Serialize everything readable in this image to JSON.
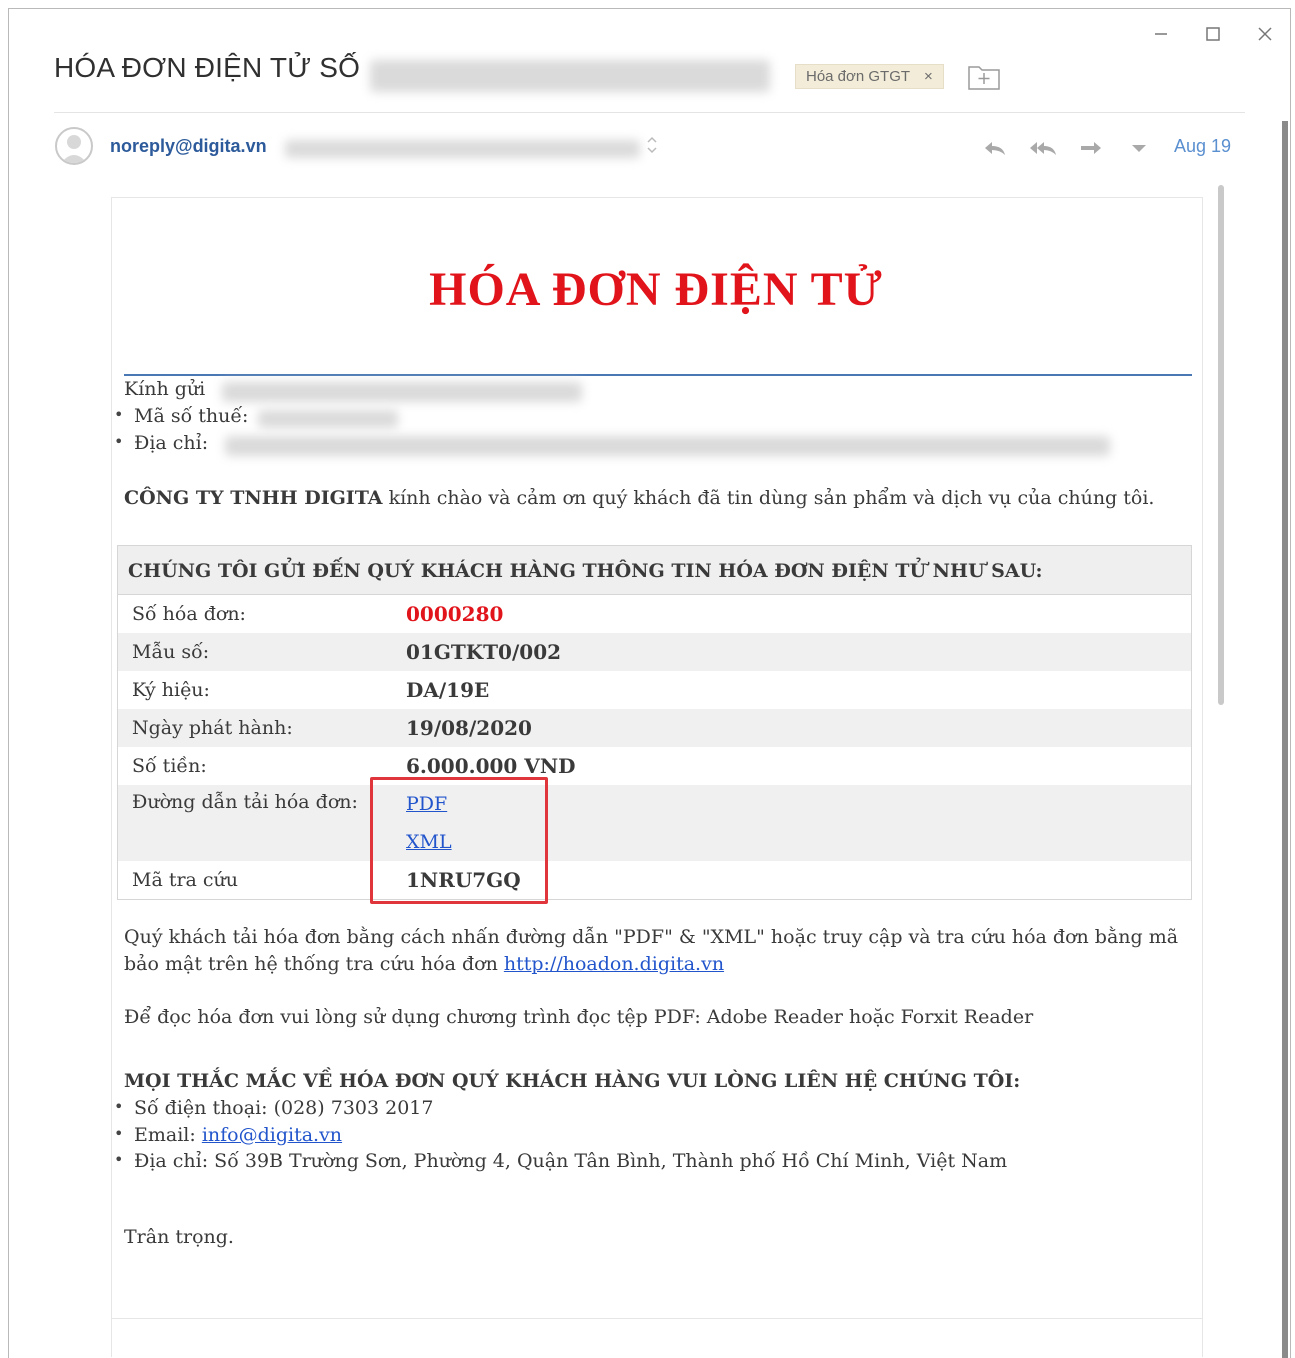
{
  "window": {
    "controls": [
      "minimize",
      "maximize",
      "close"
    ]
  },
  "header": {
    "subject": "HÓA ĐƠN ĐIỆN TỬ SỐ",
    "tag_label": "Hóa đơn GTGT",
    "tag_close": "×"
  },
  "message": {
    "sender": "noreply@digita.vn",
    "date": "Aug 19",
    "actions": [
      "reply",
      "reply-all",
      "forward",
      "more"
    ]
  },
  "body": {
    "title": "HÓA ĐƠN ĐIỆN TỬ",
    "salutation": "Kính gửi",
    "tax_code_label": "Mã số thuế:",
    "address_label": "Địa chỉ:",
    "company_name": "CÔNG TY TNHH DIGITA",
    "greeting": " kính chào và cảm ơn quý khách đã tin dùng sản phẩm và dịch vụ của chúng tôi.",
    "table_header": "CHÚNG TÔI GỬI ĐẾN QUÝ KHÁCH HÀNG THÔNG TIN HÓA ĐƠN ĐIỆN TỬ NHƯ SAU:",
    "rows": [
      {
        "label": "Số hóa đơn:",
        "value": "0000280"
      },
      {
        "label": "Mẫu số:",
        "value": "01GTKT0/002"
      },
      {
        "label": "Ký hiệu:",
        "value": "DA/19E"
      },
      {
        "label": "Ngày phát hành:",
        "value": "19/08/2020"
      },
      {
        "label": "Số tiền:",
        "value": "6.000.000 VND"
      }
    ],
    "download_label": "Đường dẫn tải hóa đơn:",
    "link_pdf": "PDF",
    "link_xml": "XML",
    "lookup_label": "Mã tra cứu",
    "lookup_value": "1NRU7GQ",
    "instruction_line1": "Quý khách tải hóa đơn bằng cách nhấn đường dẫn \"PDF\" & \"XML\" hoặc truy cập và tra cứu hóa đơn bằng mã",
    "instruction_line2": "bảo mật trên hệ thống tra cứu hóa đơn ",
    "lookup_url": "http://hoadon.digita.vn",
    "reader_note": "Để đọc hóa đơn vui lòng sử dụng chương trình đọc tệp PDF: Adobe Reader hoặc Forxit Reader",
    "contact_title": "MỌI THẮC MẮC VỀ HÓA ĐƠN QUÝ KHÁCH HÀNG VUI LÒNG LIÊN HỆ CHÚNG TÔI:",
    "phone": "Số điện thoại: (028) 7303 2017",
    "email_label": "Email: ",
    "email": "info@digita.vn",
    "contact_address": "Địa chỉ: Số 39B Trường Sơn, Phường 4, Quận Tân Bình, Thành phố Hồ Chí Minh, Việt Nam",
    "signoff": "Trân trọng."
  },
  "colors": {
    "title_red": "#e1141b",
    "link_blue": "#2255cc",
    "sender_blue": "#2c5a9a",
    "highlight_red": "#e0353b"
  }
}
